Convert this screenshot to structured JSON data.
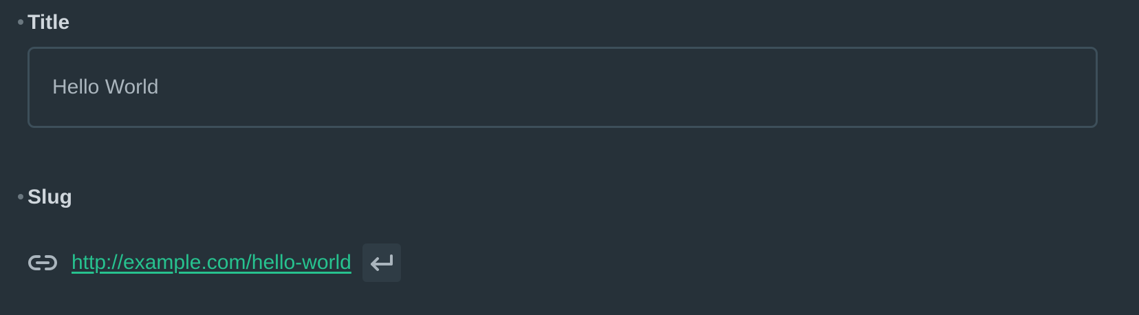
{
  "title_field": {
    "label": "Title",
    "value": "Hello World"
  },
  "slug_field": {
    "label": "Slug",
    "url": "http://example.com/hello-world",
    "link_icon": "link-icon",
    "action_icon": "enter-return-icon"
  },
  "colors": {
    "background": "#263139",
    "link": "#27c28f",
    "label": "#cfd6dc",
    "input_border": "#3d4f5a"
  }
}
